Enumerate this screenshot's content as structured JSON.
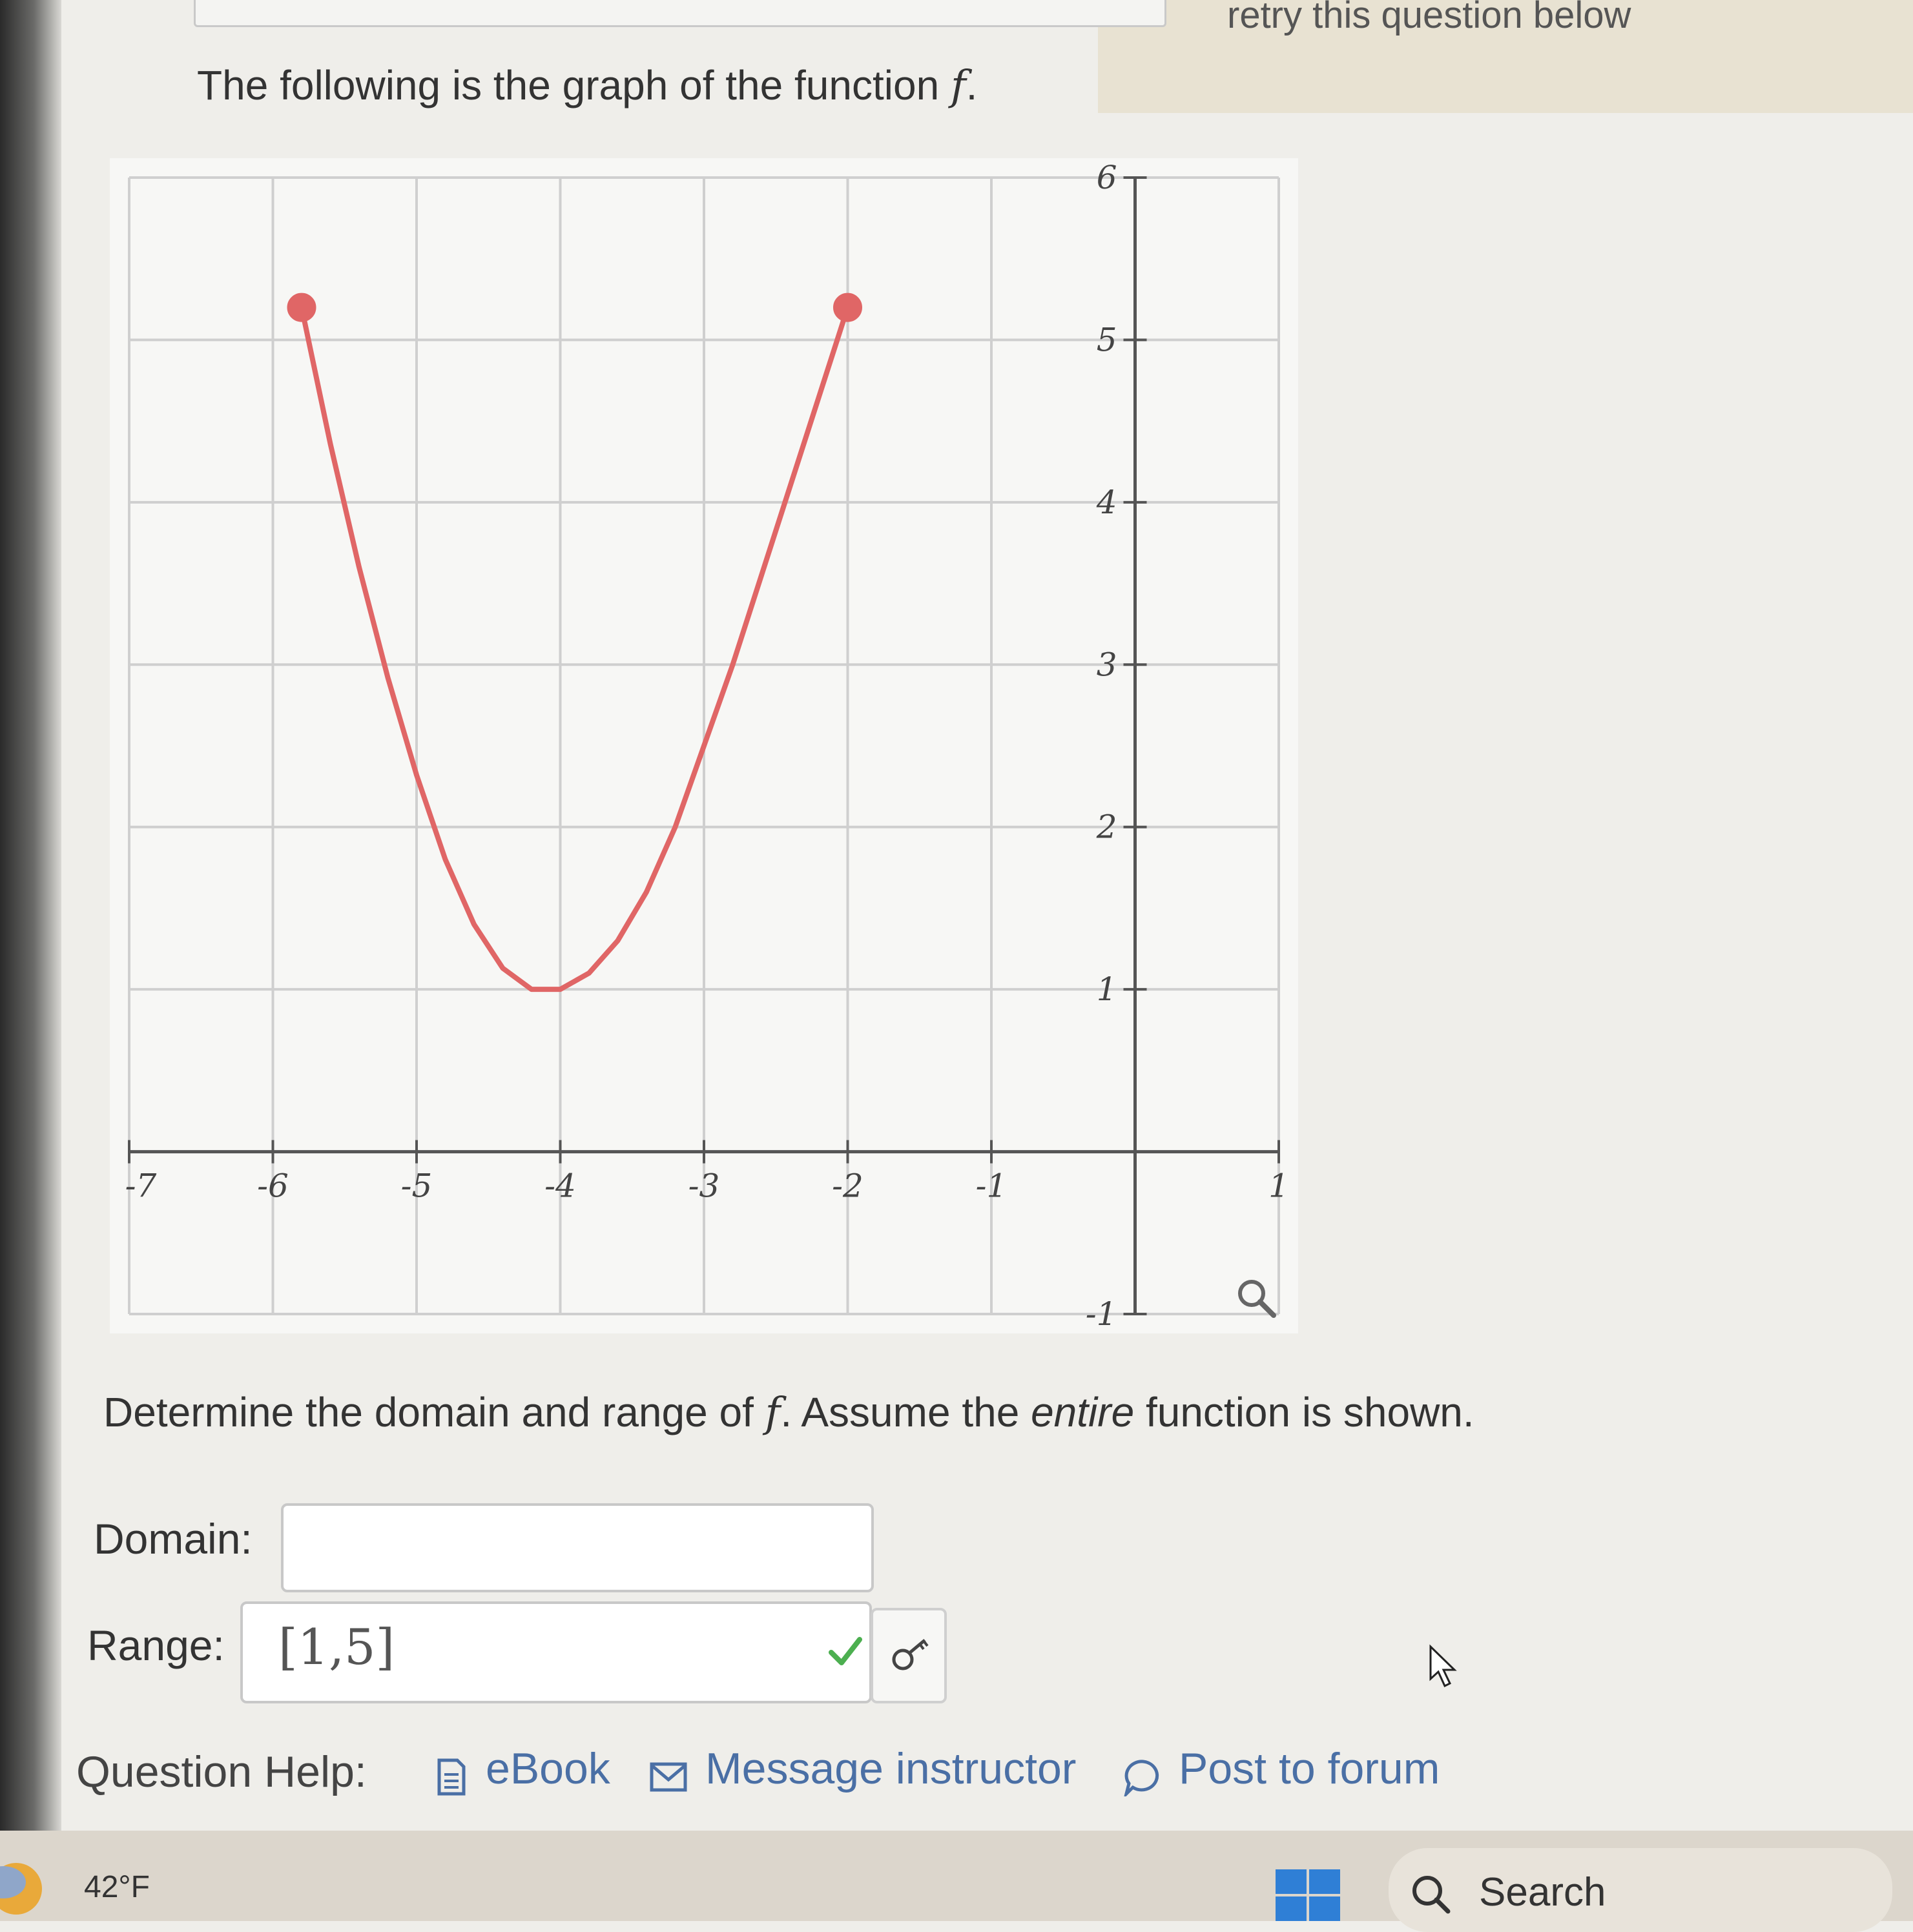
{
  "header": {
    "retry_text": "retry this question below"
  },
  "question": {
    "intro_prefix": "The following is the graph of the function ",
    "function_symbol": "f",
    "intro_suffix": ".",
    "instruction_prefix": "Determine the domain and range of ",
    "instruction_mid": ". Assume the ",
    "instruction_emph": "entire",
    "instruction_suffix": " function is shown."
  },
  "chart_data": {
    "type": "line",
    "x_ticks": [
      "-7",
      "-6",
      "-5",
      "-4",
      "-3",
      "-2",
      "-1",
      "1"
    ],
    "y_ticks": [
      "-1",
      "1",
      "2",
      "3",
      "4",
      "5",
      "6"
    ],
    "xlim": [
      -7,
      1
    ],
    "ylim": [
      -1,
      6
    ],
    "grid": true,
    "series": [
      {
        "color": "#e06666",
        "x": [
          -5.8,
          -5.6,
          -5.4,
          -5.2,
          -5.0,
          -4.8,
          -4.6,
          -4.4,
          -4.2,
          -4.0,
          -3.8,
          -3.6,
          -3.4,
          -3.2,
          -3.0,
          -2.8,
          -2.6,
          -2.4,
          -2.2,
          -2.0
        ],
        "y": [
          5.2,
          4.36,
          3.6,
          2.92,
          2.32,
          1.8,
          1.4,
          1.13,
          1.0,
          1.0,
          1.1,
          1.3,
          1.6,
          2.0,
          2.5,
          3.0,
          3.55,
          4.1,
          4.65,
          5.2
        ]
      }
    ],
    "endpoints": [
      {
        "x": -5.8,
        "y": 5.2,
        "closed": true
      },
      {
        "x": -2.0,
        "y": 5.2,
        "closed": true
      }
    ]
  },
  "form": {
    "domain_label": "Domain:",
    "domain_value": "",
    "range_label": "Range:",
    "range_value": "[1,5]"
  },
  "help": {
    "label": "Question Help:",
    "ebook": "eBook",
    "message": "Message instructor",
    "forum": "Post to forum"
  },
  "taskbar": {
    "weather": "42°F",
    "search_placeholder": "Search"
  }
}
